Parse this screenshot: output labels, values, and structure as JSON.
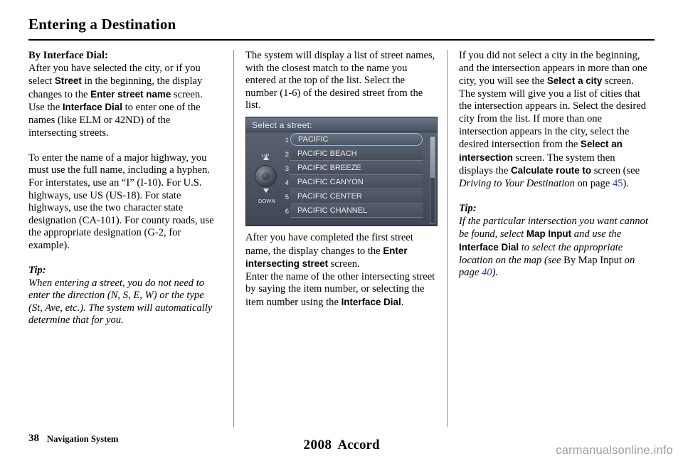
{
  "page": {
    "title": "Entering a Destination",
    "footer_page_number": "38",
    "footer_section": "Navigation System",
    "footer_year": "2008",
    "footer_model": "Accord",
    "watermark": "carmanualsonline.info"
  },
  "column1": {
    "heading": "By Interface Dial:",
    "para1_a": "After you have selected the city, or if you select ",
    "para1_street": "Street",
    "para1_b": " in the beginning, the display changes to the ",
    "para1_enter_street_name": "Enter street name",
    "para1_c": " screen. Use the ",
    "para1_interface_dial": "Interface Dial",
    "para1_d": " to enter one of the names (like ELM or 42ND) of the intersecting streets.",
    "para2": "To enter the name of a major highway, you must use the full name, including a hyphen. For interstates, use an “I” (I-10). For U.S. highways, use US (US-18). For state highways, use the two character state designation (CA-101). For county roads, use the appropriate designation (G-2, for example).",
    "tip_label": "Tip:",
    "tip_text": "When entering a street, you do not need to enter the direction (N, S, E, W) or the type (St, Ave, etc.). The system will automatically determine that for you."
  },
  "column2": {
    "para1": "The system will display a list of street names, with the closest match to the name you entered at the top of the list. Select the number (1-6) of the desired street from the list.",
    "screen": {
      "header": "Select a street:",
      "dial_up_label": "UP",
      "dial_down_label": "DOWN",
      "numbers": [
        "1",
        "2",
        "3",
        "4",
        "5",
        "6"
      ],
      "items": [
        "PACIFIC",
        "PACIFIC BEACH",
        "PACIFIC BREEZE",
        "PACIFIC CANYON",
        "PACIFIC CENTER",
        "PACIFIC CHANNEL"
      ]
    },
    "para2_a": "After you have completed the first street name, the display changes to the ",
    "para2_enter_intersecting": "Enter intersecting street",
    "para2_b": " screen.",
    "para3_a": "Enter the name of the other intersecting street by saying the item number, or selecting the item number using the ",
    "para3_interface_dial": "Interface Dial",
    "para3_b": "."
  },
  "column3": {
    "para1_a": "If you did not select a city in the beginning, and the intersection appears in more than one city, you will see the ",
    "para1_select_city": "Select a city",
    "para1_b": " screen. The system will give you a list of cities that the intersection appears in. Select the desired city from the list. If more than one intersection appears in the city, select the desired intersection from the ",
    "para1_select_intersection": "Select an intersection",
    "para1_c": " screen. The system then displays the ",
    "para1_calculate_route": "Calculate route to",
    "para1_d": " screen (see ",
    "para1_driving_italic": "Driving to Your Destination",
    "para1_e": " on page ",
    "para1_page_ref": "45",
    "para1_f": ").",
    "tip_label": "Tip:",
    "tip_a": "If the particular intersection you want cannot be found, select ",
    "tip_map_input": "Map Input",
    "tip_b": " and use the ",
    "tip_interface_dial": "Interface Dial",
    "tip_c": " to select the appropriate location on the map (see ",
    "tip_bymap_italic": "By Map Input",
    "tip_d": " on page ",
    "tip_page_ref": "40",
    "tip_e": ")."
  }
}
